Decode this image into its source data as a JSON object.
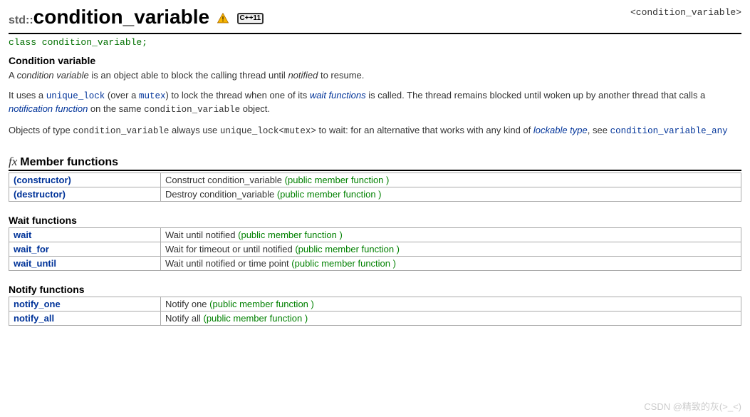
{
  "header": {
    "namespace": "std::",
    "class_name": "condition_variable",
    "include": "<condition_variable>",
    "cpp_badge": "C++11"
  },
  "declaration": "class condition_variable;",
  "subtitle": "Condition variable",
  "intro": {
    "p1_a": "A ",
    "p1_em": "condition variable",
    "p1_b": " is an object able to block the calling thread until ",
    "p1_em2": "notified",
    "p1_c": " to resume.",
    "p2_a": "It uses a ",
    "p2_uniquelock": "unique_lock",
    "p2_b": " (over a ",
    "p2_mutex": "mutex",
    "p2_c": ") to lock the thread when one of its ",
    "p2_link1": "wait functions",
    "p2_d": " is called. The thread remains blocked until woken up by another thread that calls a ",
    "p2_link2": "notification function",
    "p2_e": " on the same ",
    "p2_cv": "condition_variable",
    "p2_f": " object.",
    "p3_a": "Objects of type ",
    "p3_cv": "condition_variable",
    "p3_b": " always use ",
    "p3_ulmutex": "unique_lock<mutex>",
    "p3_c": " to wait: for an alternative that works with any kind of ",
    "p3_link": "lockable type",
    "p3_d": ", see ",
    "p3_cvany": "condition_variable_any"
  },
  "sections": {
    "member_functions": "Member functions",
    "wait_functions": "Wait functions",
    "notify_functions": "Notify functions"
  },
  "rows": {
    "constructor": {
      "name": "(constructor)",
      "desc": "Construct condition_variable",
      "annot": "(public member function )"
    },
    "destructor": {
      "name": "(destructor)",
      "desc": "Destroy condition_variable",
      "annot": "(public member function )"
    },
    "wait": {
      "name": "wait",
      "desc": "Wait until notified",
      "annot": "(public member function )"
    },
    "wait_for": {
      "name": "wait_for",
      "desc": "Wait for timeout or until notified",
      "annot": "(public member function )"
    },
    "wait_until": {
      "name": "wait_until",
      "desc": "Wait until notified or time point",
      "annot": "(public member function )"
    },
    "notify_one": {
      "name": "notify_one",
      "desc": "Notify one",
      "annot": "(public member function )"
    },
    "notify_all": {
      "name": "notify_all",
      "desc": "Notify all",
      "annot": "(public member function )"
    }
  },
  "watermark": "CSDN @精致的灰(>_<)"
}
